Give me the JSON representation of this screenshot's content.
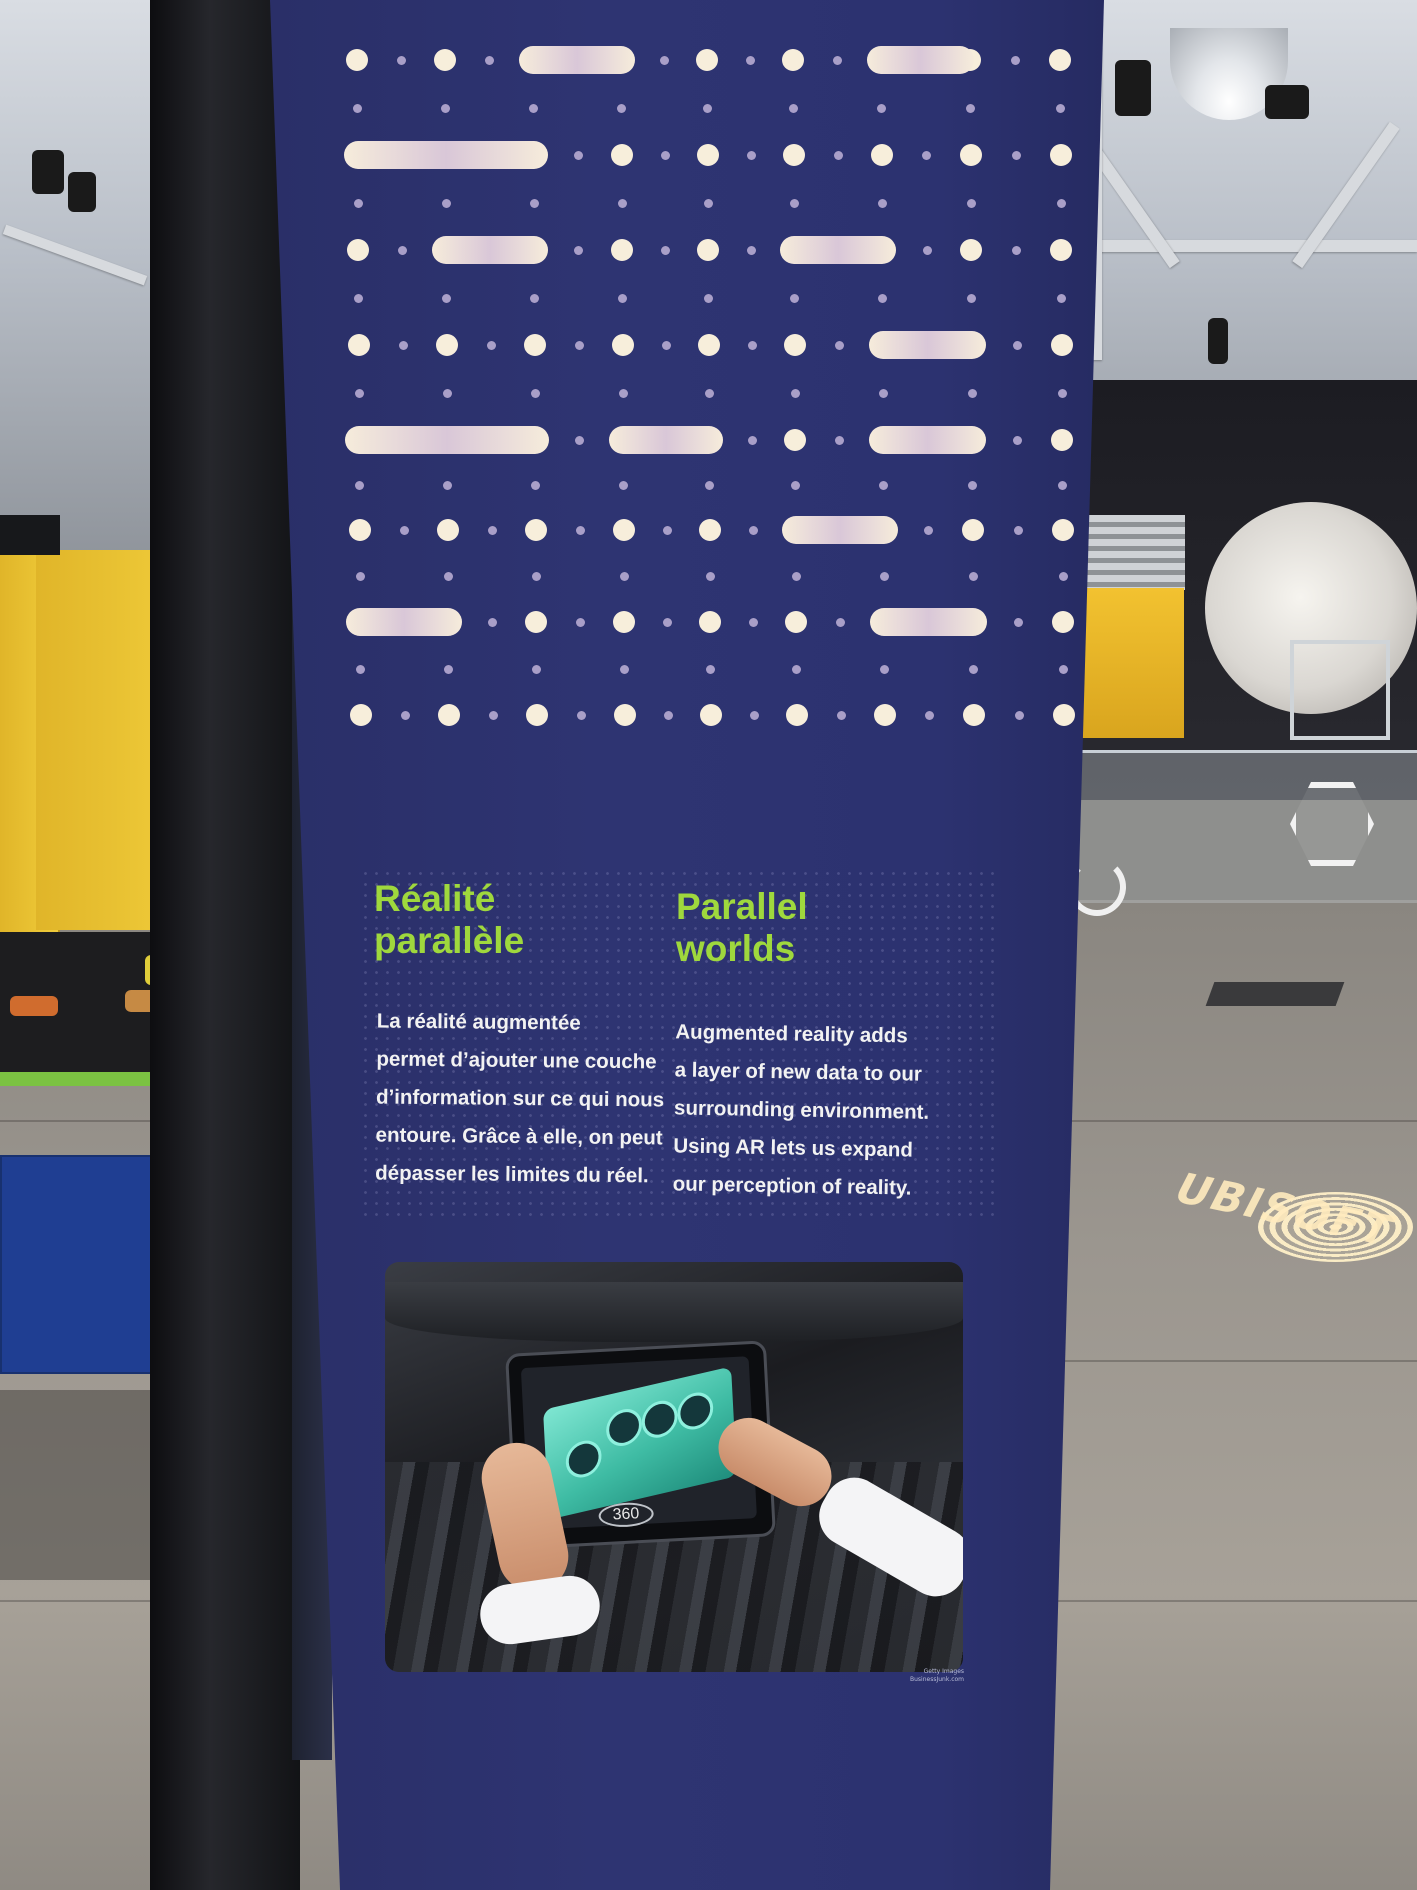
{
  "sign": {
    "french": {
      "heading": "Réalité\nparallèle",
      "body": "La réalité augmentée\npermet d’ajouter une couche\nd’information sur ce qui nous\nentoure. Grâce à elle, on peut\ndépasser les limites du réel."
    },
    "english": {
      "heading": "Parallel\nworlds",
      "body": "Augmented reality adds\na layer of new data to our\nsurrounding environment.\nUsing AR lets us expand\nour perception of reality."
    },
    "photo": {
      "badge": "360",
      "credit": "Getty Images\nBusinessJunk.com"
    }
  },
  "background": {
    "floor_projection": "UBISOFT"
  },
  "colors": {
    "panel": "#2e3472",
    "heading": "#9fd83d",
    "body_text": "#f2f2f2",
    "big_dot": "#f7eedb",
    "small_dot": "#a99fc8"
  }
}
